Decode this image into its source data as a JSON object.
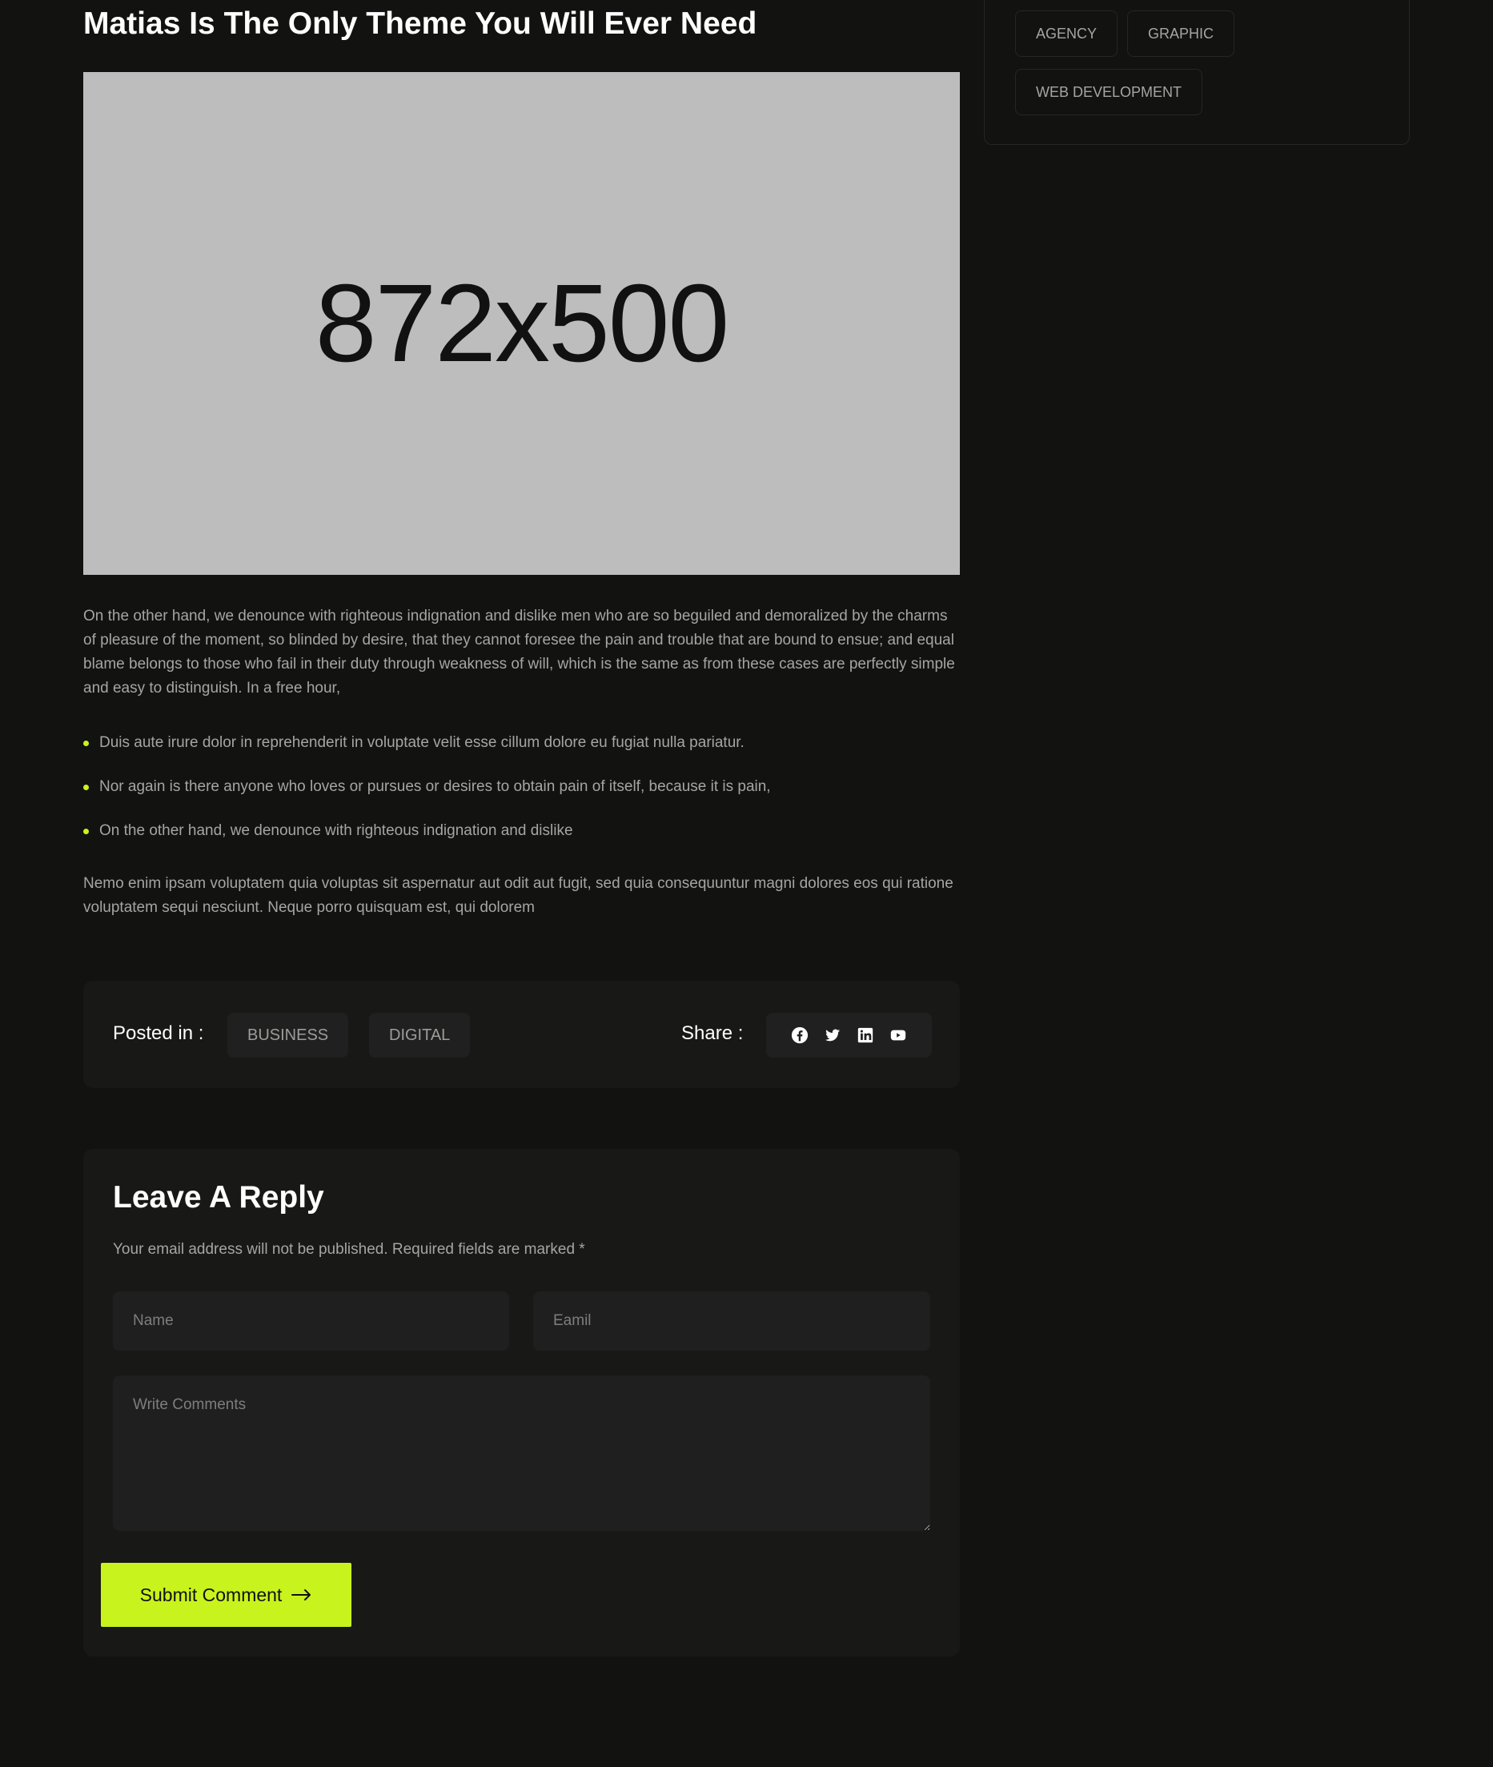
{
  "post": {
    "title": "Matias Is The Only Theme You Will Ever Need",
    "image_placeholder": "872x500",
    "paragraph_1": "On the other hand, we denounce with righteous indignation and dislike men who are so beguiled and demoralized by the charms of pleasure of the moment, so blinded by desire, that they cannot foresee the pain and trouble that are bound to ensue; and equal blame belongs to those who fail in their duty through weakness of will, which is the same as from these cases are perfectly simple and easy to distinguish. In a free hour,",
    "bullets": [
      "Duis aute irure dolor in reprehenderit in voluptate velit esse cillum dolore eu fugiat nulla pariatur.",
      "Nor again is there anyone who loves or pursues or desires to obtain pain of itself, because it is pain,",
      "On the other hand, we denounce with righteous indignation and dislike"
    ],
    "paragraph_2": "Nemo enim ipsam voluptatem quia voluptas sit aspernatur aut odit aut fugit, sed quia consequuntur magni dolores eos qui ratione voluptatem sequi nesciunt. Neque porro quisquam est, qui dolorem"
  },
  "meta": {
    "posted_in_label": "Posted in :",
    "categories": [
      "BUSINESS",
      "DIGITAL"
    ],
    "share_label": "Share :",
    "share_icons": [
      "facebook-icon",
      "twitter-icon",
      "linkedin-icon",
      "youtube-icon"
    ]
  },
  "reply": {
    "title": "Leave A Reply",
    "note": "Your email address will not be published. Required fields are marked *",
    "name_placeholder": "Name",
    "email_placeholder": "Eamil",
    "comment_placeholder": "Write Comments",
    "submit_label": "Submit Comment"
  },
  "sidebar": {
    "tags": [
      "AGENCY",
      "GRAPHIC",
      "WEB DEVELOPMENT"
    ]
  },
  "colors": {
    "background": "#121210",
    "panel": "#181816",
    "accent": "#c9f31d",
    "text_muted": "#a5a5a2",
    "image_placeholder_bg": "#bdbdbd"
  }
}
